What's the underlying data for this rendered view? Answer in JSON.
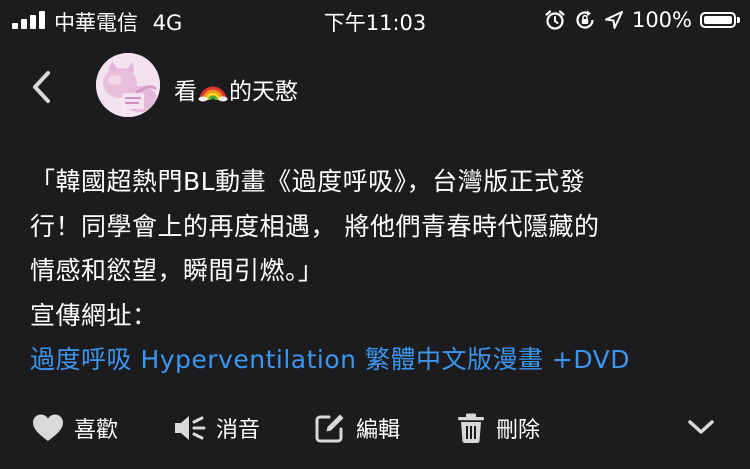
{
  "status_bar": {
    "carrier": "中華電信",
    "network": "4G",
    "time": "下午11:03",
    "battery_percent": "100%",
    "battery_level": 1.0,
    "signal_bars": 4,
    "icons": [
      "signal-icon",
      "alarm-icon",
      "orientation-lock-icon",
      "location-icon",
      "battery-icon"
    ]
  },
  "header": {
    "back_icon": "chevron-left-icon",
    "avatar_icon": "avatar",
    "name_prefix": "看",
    "name_emoji_icon": "rainbow-emoji",
    "name_suffix": "的天憨"
  },
  "message": {
    "lines": [
      "「韓國超熱門BL動畫《過度呼吸》，台灣版正式發",
      "行！同學會上的再度相遇， 將他們青春時代隱藏的",
      "情感和慾望，瞬間引燃。」",
      "宣傳網址："
    ],
    "link_text": "過度呼吸 Hyperventilation 繁體中文版漫畫 +DVD",
    "link_color": "#3c95ee"
  },
  "actions": {
    "like": {
      "label": "喜歡",
      "icon": "heart-icon"
    },
    "mute": {
      "label": "消音",
      "icon": "speaker-mute-icon"
    },
    "edit": {
      "label": "編輯",
      "icon": "edit-icon"
    },
    "delete": {
      "label": "刪除",
      "icon": "trash-icon"
    },
    "more_icon": "chevron-down-icon"
  },
  "colors": {
    "background": "#1c1c1e",
    "text": "#ffffff",
    "icon": "#d9d9d9",
    "accent": "#3c95ee"
  }
}
